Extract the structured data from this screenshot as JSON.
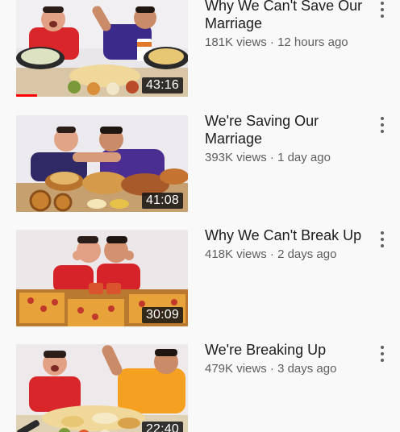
{
  "videos": [
    {
      "title": "Why We Can't Save Our Marriage",
      "views": "181K views",
      "age": "12 hours ago",
      "duration": "43:16",
      "watched_fraction": 0.12
    },
    {
      "title": "We're Saving Our Marriage",
      "views": "393K views",
      "age": "1 day ago",
      "duration": "41:08"
    },
    {
      "title": "Why We Can't Break Up",
      "views": "418K views",
      "age": "2 days ago",
      "duration": "30:09"
    },
    {
      "title": "We're Breaking Up",
      "views": "479K views",
      "age": "3 days ago",
      "duration": "22:40"
    }
  ],
  "separator": " · ",
  "colors": {
    "progress": "#ff0000",
    "shirt_red": "#d9262b",
    "shirt_purple": "#3b2a8a",
    "shirt_orange": "#f6a021",
    "table_wood": "#b9792f"
  },
  "icons": {
    "menu": "more-vert-icon"
  }
}
